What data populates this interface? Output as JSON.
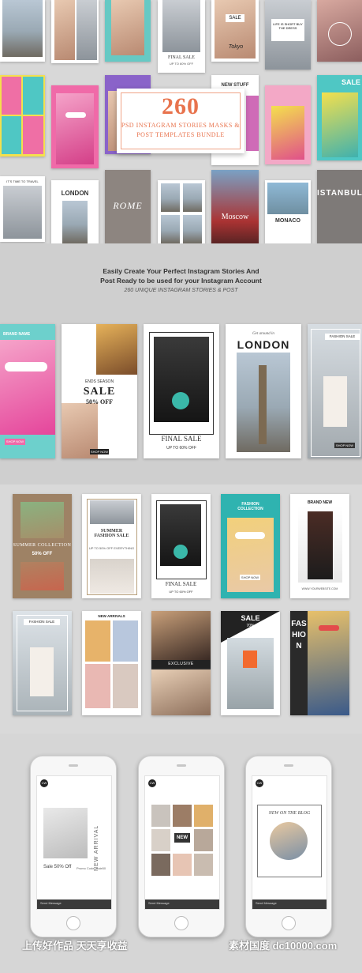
{
  "bundle_banner": {
    "count": "260",
    "line1": "PSD INSTAGRAM STORIES MASKS &",
    "line2": "POST TEMPLATES BUNDLE"
  },
  "top_collage": {
    "final_sale": "FINAL SALE",
    "final_sale_sub": "UP TO 60% OFF",
    "sale": "SALE",
    "tokyo": "Tokyo",
    "quote": "LIFE IS SHORT BUY THE DRESS",
    "new_stuff": "NEW STUFF",
    "sale_right": "SALE",
    "travel": "IT'S TIME TO TRAVEL",
    "london": "LONDON",
    "rome": "ROME",
    "moscow": "Moscow",
    "monaco": "MONACO",
    "istanbul": "ISTANBUL"
  },
  "tagline": {
    "line1": "Easily Create Your  Perfect  Instagram Stories And",
    "line2": "Post Ready to be used for your Instagram Account",
    "line3": "260 UNIQUE INSTAGRAM STORIES & POST"
  },
  "story_row": {
    "brand_name": "BRAND NAME",
    "shop_now": "SHOP NOW",
    "ends_season": "ENDS SEASON",
    "sale": "SALE",
    "percent": "50% OFF",
    "shop_now2": "SHOP NOW",
    "final_sale": "FINAL SALE",
    "final_sale_sub": "UP TO 60% OFF",
    "get_around": "Get around in",
    "london": "LONDON",
    "fashion_sale": "FASHION SALE",
    "shop_now3": "SHOP NOW"
  },
  "grid": {
    "summer_collection": "SUMMER COLLECTION",
    "fifty_off": "50% OFF",
    "summer_fashion_sale": "SUMMER FASHION SALE",
    "up_to": "UP TO 50% OFF EVERYTHING",
    "final_sale": "FINAL SALE",
    "final_sale_sub": "UP TO 60% OFF",
    "fashion_collection": "FASHION COLLECTION",
    "shop_now": "SHOP NOW",
    "brand_new": "BRAND NEW",
    "website": "WWW.YOURWEBSITE.COM",
    "fashion_sale": "FASHION SALE",
    "new_arrivals": "NEW ARRIVALS",
    "exclusive": "EXCLUSIVE",
    "sale": "SALE",
    "seventy": "70%",
    "fashion_vertical": "FASHION"
  },
  "phones": [
    {
      "logo": "CW",
      "headline": "NEW ARRIVAL",
      "caption": "Sale 50% Off",
      "promo": "Promo Code: Sale50",
      "send": "Send Message"
    },
    {
      "logo": "CW",
      "badge": "NEW",
      "send": "Send Message"
    },
    {
      "logo": "CW",
      "headline": "NEW ON THE BLOG",
      "send": "Send Message"
    }
  ],
  "watermark": {
    "left": "上传好作品  天天享收益",
    "right": "素材国度  dc10000.com"
  },
  "colors": {
    "banner_accent": "#e8734d",
    "pink": "#f06aa8",
    "teal": "#4fc7c4",
    "yellow": "#f4e04d",
    "sale_orange": "#e94e25"
  }
}
